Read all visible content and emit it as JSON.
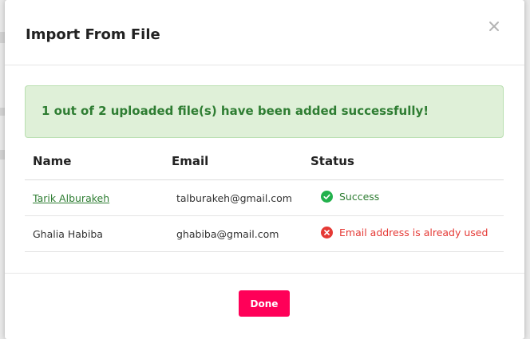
{
  "modal": {
    "title": "Import From File",
    "close_icon": "close-icon",
    "alert_message": "1 out of 2 uploaded file(s) have been added successfully!",
    "colors": {
      "alert_bg": "#dff0d8",
      "alert_text": "#2e7d32",
      "success": "#2e7d32",
      "error": "#e53935",
      "primary_button": "#ff0058"
    }
  },
  "table": {
    "headers": [
      "Name",
      "Email",
      "Status"
    ],
    "rows": [
      {
        "name": "Tarik Alburakeh",
        "email": "talburakeh@gmail.com",
        "status": "Success",
        "status_icon": "check-circle-icon"
      },
      {
        "name": "Ghalia Habiba",
        "email": "ghabiba@gmail.com",
        "status": "Email address is already used",
        "status_icon": "error-circle-icon"
      }
    ]
  },
  "footer": {
    "done_label": "Done"
  }
}
